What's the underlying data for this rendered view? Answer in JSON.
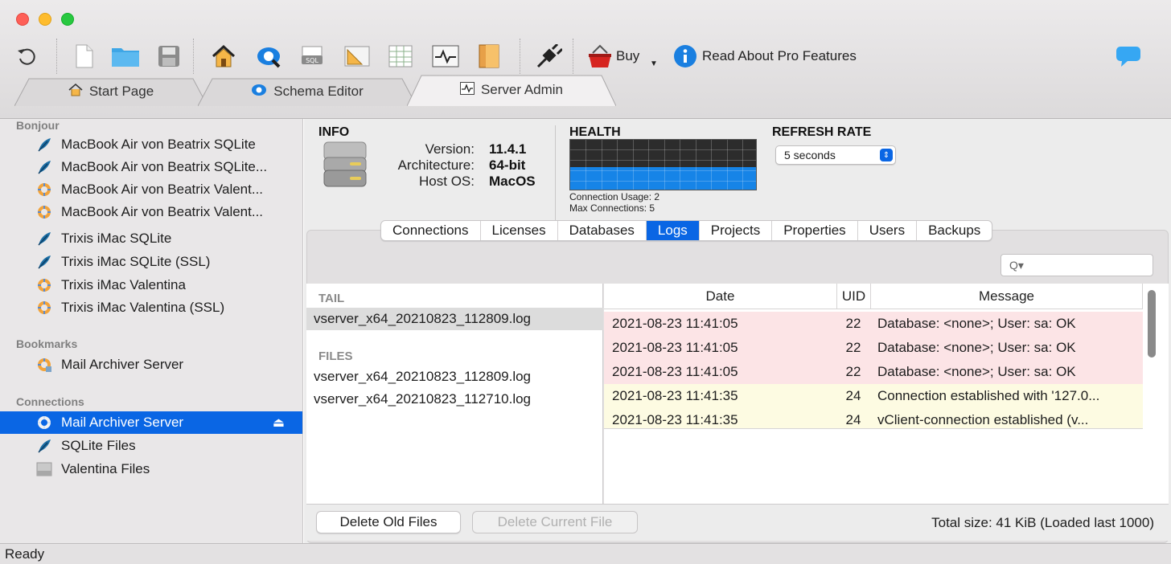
{
  "toolbar": {
    "buy_label": "Buy",
    "pro_label": "Read About Pro Features",
    "icons": [
      "refresh-icon",
      "new-document-icon",
      "open-folder-icon",
      "save-icon",
      "home-icon",
      "schema-icon",
      "sql-icon",
      "ruler-icon",
      "table-icon",
      "activity-icon",
      "book-icon",
      "plug-icon",
      "basket-icon",
      "info-icon",
      "chat-icon"
    ]
  },
  "tabs": [
    {
      "label": "Start Page",
      "active": false
    },
    {
      "label": "Schema Editor",
      "active": false
    },
    {
      "label": "Server Admin",
      "active": true
    }
  ],
  "sidebar": {
    "bonjour": {
      "heading": "Bonjour",
      "items": [
        {
          "label": "MacBook Air von Beatrix SQLite",
          "icon": "sqlite-feather-icon"
        },
        {
          "label": "MacBook Air von Beatrix SQLite...",
          "icon": "sqlite-feather-icon"
        },
        {
          "label": "MacBook Air von Beatrix Valent...",
          "icon": "valentina-icon"
        },
        {
          "label": "MacBook Air von Beatrix Valent...",
          "icon": "valentina-icon"
        },
        {
          "label": "Trixis iMac SQLite",
          "icon": "sqlite-feather-icon"
        },
        {
          "label": "Trixis iMac SQLite (SSL)",
          "icon": "sqlite-feather-icon"
        },
        {
          "label": "Trixis iMac Valentina",
          "icon": "valentina-icon"
        },
        {
          "label": "Trixis iMac Valentina (SSL)",
          "icon": "valentina-icon"
        }
      ]
    },
    "bookmarks": {
      "heading": "Bookmarks",
      "items": [
        {
          "label": "Mail Archiver Server",
          "icon": "valentina-bookmark-icon"
        }
      ]
    },
    "connections": {
      "heading": "Connections",
      "items": [
        {
          "label": "Mail Archiver Server",
          "icon": "valentina-icon",
          "selected": true,
          "eject": "⏏"
        },
        {
          "label": "SQLite Files",
          "icon": "sqlite-feather-icon"
        },
        {
          "label": "Valentina Files",
          "icon": "valentina-files-icon"
        }
      ]
    }
  },
  "info": {
    "heading": "INFO",
    "version_label": "Version:",
    "version_value": "11.4.1",
    "arch_label": "Architecture:",
    "arch_value": "64-bit",
    "os_label": "Host OS:",
    "os_value": "MacOS"
  },
  "health": {
    "heading": "HEALTH",
    "usage_note": "Connection Usage: 2",
    "max_note": "Max Connections: 5",
    "usage_fraction": 0.45
  },
  "refresh": {
    "heading": "REFRESH RATE",
    "value": "5 seconds"
  },
  "subtabs": [
    {
      "label": "Connections",
      "active": false
    },
    {
      "label": "Licenses",
      "active": false
    },
    {
      "label": "Databases",
      "active": false
    },
    {
      "label": "Logs",
      "active": true
    },
    {
      "label": "Projects",
      "active": false
    },
    {
      "label": "Properties",
      "active": false
    },
    {
      "label": "Users",
      "active": false
    },
    {
      "label": "Backups",
      "active": false
    }
  ],
  "search": {
    "placeholder": "Q▾"
  },
  "logs": {
    "tail_heading": "TAIL",
    "tail_files": [
      "vserver_x64_20210823_112809.log"
    ],
    "files_heading": "FILES",
    "files": [
      "vserver_x64_20210823_112809.log",
      "vserver_x64_20210823_112710.log"
    ]
  },
  "table": {
    "columns": [
      "Date",
      "UID",
      "Message"
    ],
    "rows": [
      {
        "date": "2021-08-23 11:41:05",
        "uid": "22",
        "message": "Database: <none>; User: sa: OK",
        "color": "#fce4e6"
      },
      {
        "date": "2021-08-23 11:41:05",
        "uid": "22",
        "message": "Database: <none>; User: sa: OK",
        "color": "#fce4e6"
      },
      {
        "date": "2021-08-23 11:41:05",
        "uid": "22",
        "message": "Database: <none>; User: sa: OK",
        "color": "#fce4e6"
      },
      {
        "date": "2021-08-23 11:41:35",
        "uid": "24",
        "message": "Connection established with '127.0...",
        "color": "#fdfbe2"
      },
      {
        "date": "2021-08-23 11:41:35",
        "uid": "24",
        "message": "vClient-connection  established (v...",
        "color": "#fdfbe2"
      }
    ]
  },
  "buttons": {
    "delete_old": "Delete Old Files",
    "delete_current": "Delete Current File"
  },
  "total_size": "Total size: 41 KiB (Loaded last 1000)",
  "status": "Ready"
}
